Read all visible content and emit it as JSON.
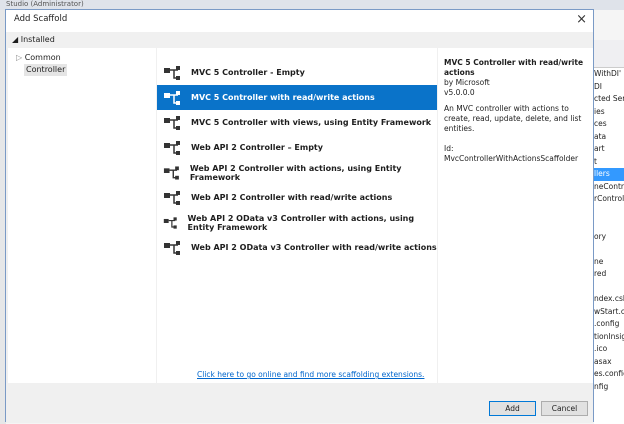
{
  "background": {
    "title_text": "Studio (Administrator)",
    "right_items": [
      "WithDI' (",
      "DI",
      "cted Servi",
      "ies",
      "ces",
      "ata",
      "art",
      "t",
      "llers",
      "neContro",
      "rControll",
      "",
      "",
      "ory",
      "",
      "ne",
      "red",
      "",
      "ndex.csh",
      "wStart.cs",
      ".config",
      "tionInsig",
      ".ico",
      "asax",
      "es.config",
      "nfig"
    ],
    "selected_index": 8
  },
  "dialog": {
    "title": "Add Scaffold",
    "close_icon": "×",
    "installed_label": "Installed",
    "tree": {
      "common": "Common",
      "controller": "Controller"
    },
    "items": [
      {
        "label": "MVC 5 Controller - Empty",
        "icon": "controller-icon"
      },
      {
        "label": "MVC 5 Controller with read/write actions",
        "icon": "controller-actions-icon"
      },
      {
        "label": "MVC 5 Controller with views, using Entity Framework",
        "icon": "controller-views-icon"
      },
      {
        "label": "Web API 2 Controller – Empty",
        "icon": "controller-icon"
      },
      {
        "label": "Web API 2 Controller with actions, using Entity Framework",
        "icon": "controller-icon"
      },
      {
        "label": "Web API 2 Controller with read/write actions",
        "icon": "controller-icon"
      },
      {
        "label": "Web API 2 OData v3 Controller with actions, using Entity Framework",
        "icon": "controller-icon"
      },
      {
        "label": "Web API 2 OData v3 Controller with read/write actions",
        "icon": "controller-icon"
      }
    ],
    "selected_index": 1,
    "link": "Click here to go online and find more scaffolding extensions.",
    "details": {
      "name": "MVC 5 Controller with read/write actions",
      "author": "by Microsoft",
      "version": "v5.0.0.0",
      "description": "An MVC controller with actions to create, read, update, delete, and list entities.",
      "id": "Id: MvcControllerWithActionsScaffolder"
    },
    "buttons": {
      "add": "Add",
      "cancel": "Cancel"
    },
    "colors": {
      "selection": "#0a73c9",
      "link": "#0066cc"
    }
  }
}
